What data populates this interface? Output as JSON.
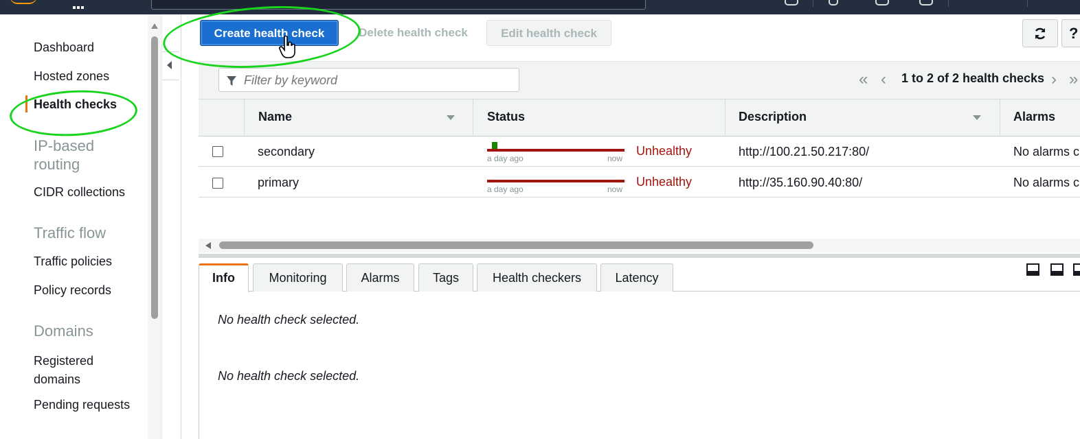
{
  "nav": {
    "items": [
      {
        "label": "Dashboard"
      },
      {
        "label": "Hosted zones"
      },
      {
        "label": "Health checks",
        "active": true
      },
      {
        "label": "CIDR collections"
      },
      {
        "label": "Traffic policies"
      },
      {
        "label": "Policy records"
      },
      {
        "label": "Registered domains"
      },
      {
        "label": "Pending requests"
      }
    ],
    "sections": {
      "ip_routing": "IP-based routing",
      "traffic_flow": "Traffic flow",
      "domains": "Domains"
    }
  },
  "toolbar": {
    "create_label": "Create health check",
    "delete_label": "Delete health check",
    "edit_label": "Edit health check",
    "refresh_icon": "refresh-icon",
    "help_icon": "help-icon"
  },
  "filter": {
    "placeholder": "Filter by keyword"
  },
  "pagination": {
    "summary": "1 to 2 of 2 health checks"
  },
  "table": {
    "columns": [
      "Name",
      "Status",
      "Description",
      "Alarms"
    ],
    "rows": [
      {
        "name": "secondary",
        "status": "Unhealthy",
        "tick_start": "a day ago",
        "tick_end": "now",
        "description": "http://100.21.50.217:80/",
        "alarms": "No alarms c"
      },
      {
        "name": "primary",
        "status": "Unhealthy",
        "tick_start": "a day ago",
        "tick_end": "now",
        "description": "http://35.160.90.40:80/",
        "alarms": "No alarms c"
      }
    ]
  },
  "detail": {
    "tabs": [
      "Info",
      "Monitoring",
      "Alarms",
      "Tags",
      "Health checkers",
      "Latency"
    ],
    "active_tab": "Info",
    "empty_message_1": "No health check selected.",
    "empty_message_2": "No health check selected."
  },
  "colors": {
    "primary_button": "#1a6fd1",
    "unhealthy": "#a0150d",
    "healthy": "#1d8102",
    "active_accent": "#ec7211",
    "annotation": "#19d41d"
  }
}
